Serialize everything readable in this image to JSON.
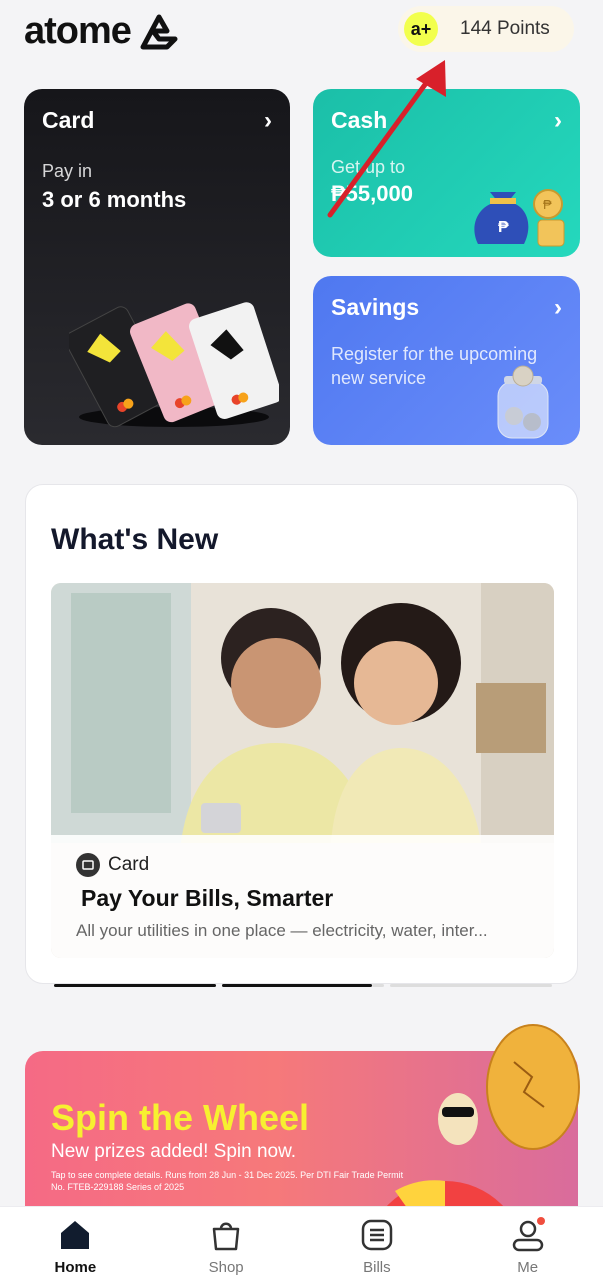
{
  "header": {
    "logo_text": "atome",
    "points_badge": "a+",
    "points_label": "144 Points"
  },
  "tiles": {
    "card": {
      "title": "Card",
      "sub": "Pay in",
      "big": "3 or 6 months"
    },
    "cash": {
      "title": "Cash",
      "sub": "Get up to",
      "big": "₱55,000"
    },
    "savings": {
      "title": "Savings",
      "sub": "Register for the upcoming new service"
    }
  },
  "whats_new": {
    "heading": "What's New",
    "category": "Card",
    "title": "Pay Your Bills, Smarter",
    "description": "All your utilities in one place — electricity, water, inter..."
  },
  "promo": {
    "title": "Spin the Wheel",
    "subtitle": "New prizes added! Spin now.",
    "fine_print": "Tap to see complete details. Runs from 28 Jun - 31 Dec 2025. Per DTI Fair Trade Permit No. FTEB-229188 Series of 2025"
  },
  "nav": [
    {
      "label": "Home",
      "icon": "home-icon",
      "active": true
    },
    {
      "label": "Shop",
      "icon": "shopping-bag-icon",
      "active": false
    },
    {
      "label": "Bills",
      "icon": "bills-icon",
      "active": false
    },
    {
      "label": "Me",
      "icon": "profile-icon",
      "active": false
    }
  ],
  "colors": {
    "accent_yellow": "#f2ff4d",
    "cash_green": "#1bbfa8",
    "savings_blue": "#4f78f0",
    "annotation_arrow": "#d8202a"
  }
}
